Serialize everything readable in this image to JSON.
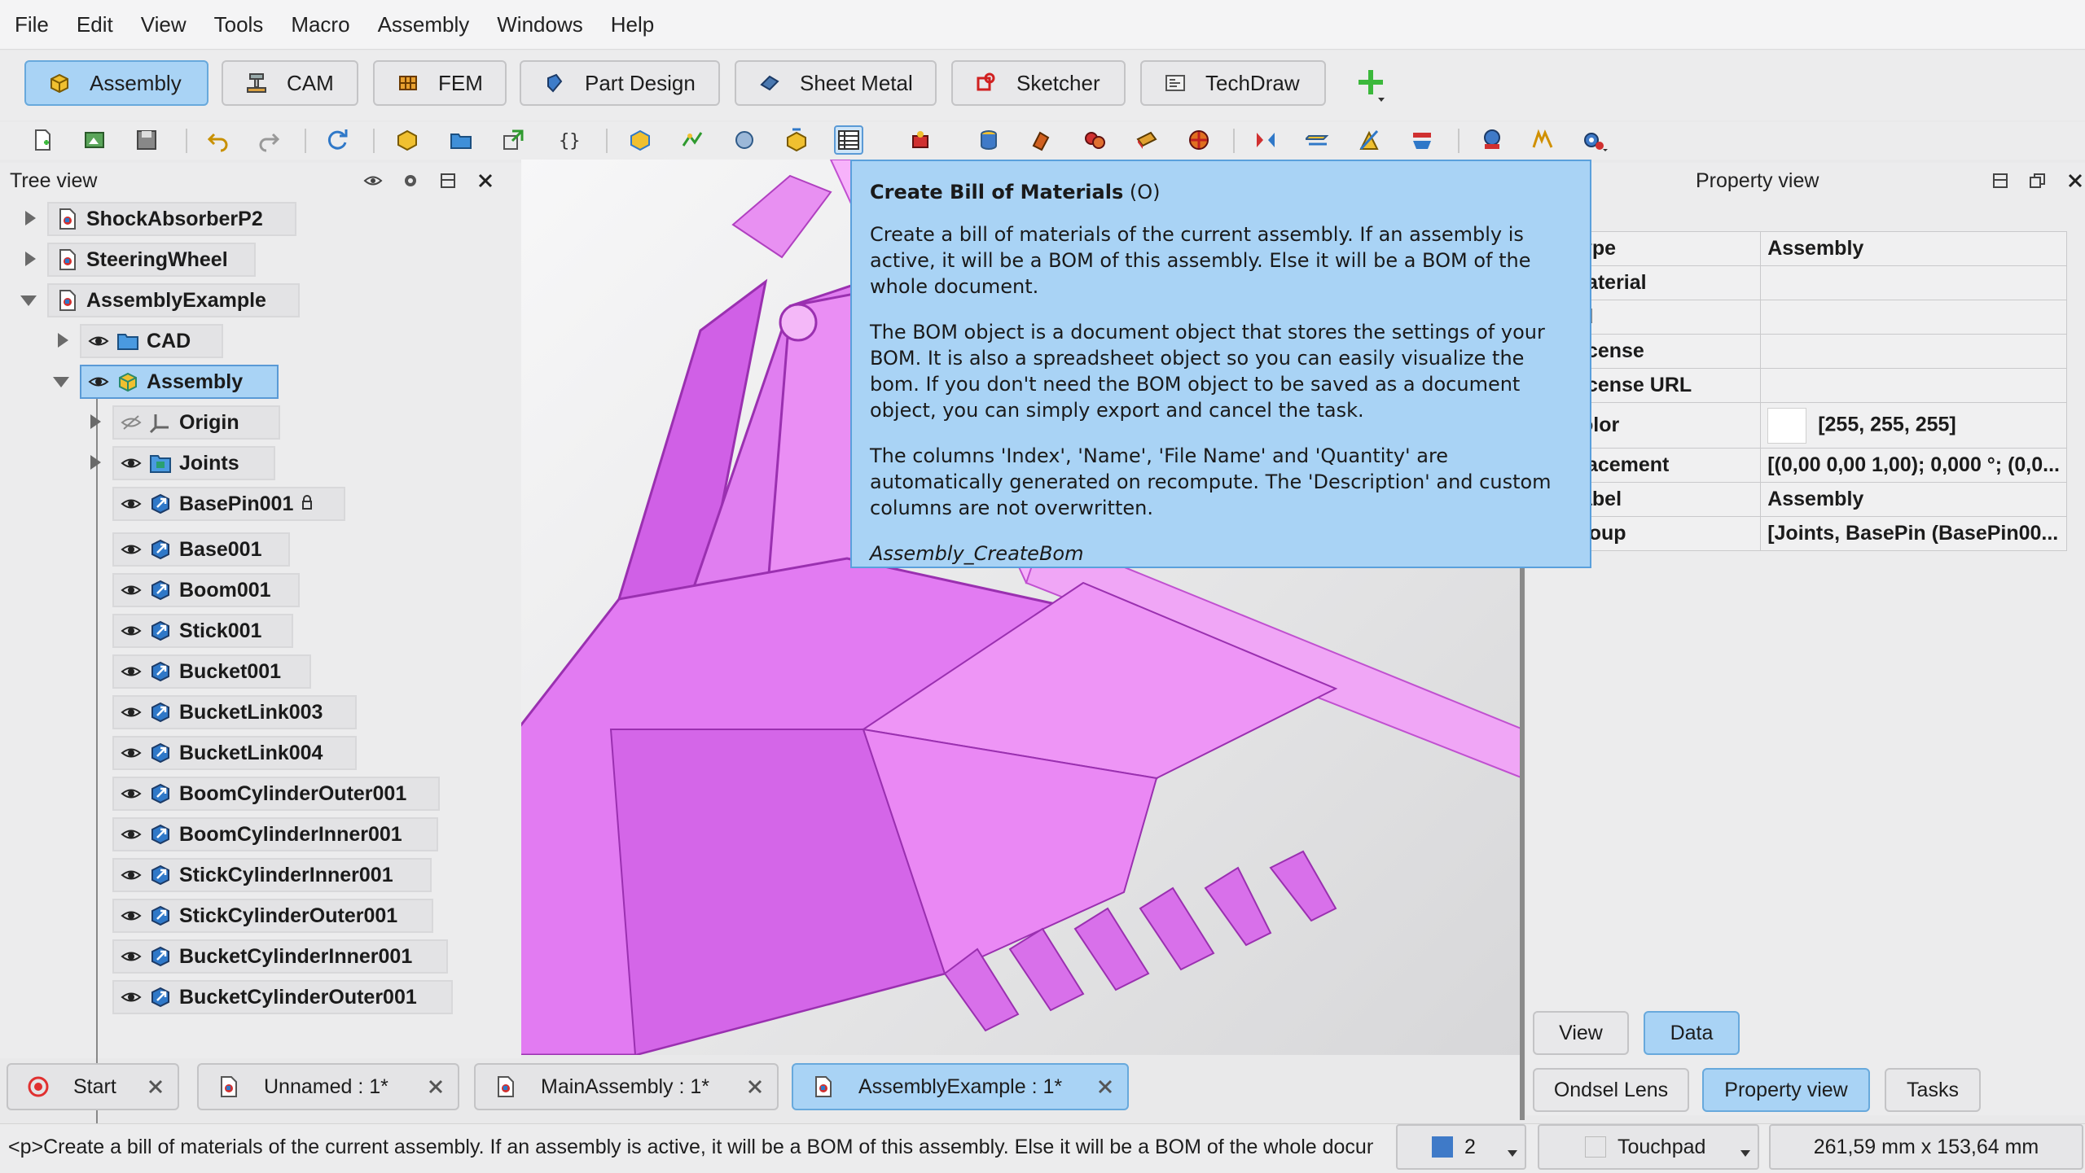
{
  "menu": [
    "File",
    "Edit",
    "View",
    "Tools",
    "Macro",
    "Assembly",
    "Windows",
    "Help"
  ],
  "workbenches": [
    {
      "label": "Assembly",
      "icon": "assembly-workbench-icon",
      "active": true
    },
    {
      "label": "CAM",
      "icon": "cam-workbench-icon",
      "active": false
    },
    {
      "label": "FEM",
      "icon": "fem-workbench-icon",
      "active": false
    },
    {
      "label": "Part Design",
      "icon": "part-design-workbench-icon",
      "active": false
    },
    {
      "label": "Sheet Metal",
      "icon": "sheet-metal-workbench-icon",
      "active": false
    },
    {
      "label": "Sketcher",
      "icon": "sketcher-workbench-icon",
      "active": false
    },
    {
      "label": "TechDraw",
      "icon": "techdraw-workbench-icon",
      "active": false
    }
  ],
  "tree": {
    "title": "Tree view",
    "items": [
      {
        "label": "ShockAbsorberP2",
        "icon": "document-icon"
      },
      {
        "label": "SteeringWheel",
        "icon": "document-icon"
      },
      {
        "label": "AssemblyExample",
        "icon": "document-icon"
      },
      {
        "label": "CAD",
        "icon": "folder-icon"
      },
      {
        "label": "Assembly",
        "icon": "assembly-icon"
      },
      {
        "label": "Origin",
        "icon": "origin-icon"
      },
      {
        "label": "Joints",
        "icon": "joints-icon"
      },
      {
        "label": "BasePin001",
        "icon": "link-icon"
      },
      {
        "label": "Base001",
        "icon": "link-icon"
      },
      {
        "label": "Boom001",
        "icon": "link-icon"
      },
      {
        "label": "Stick001",
        "icon": "link-icon"
      },
      {
        "label": "Bucket001",
        "icon": "link-icon"
      },
      {
        "label": "BucketLink003",
        "icon": "link-icon"
      },
      {
        "label": "BucketLink004",
        "icon": "link-icon"
      },
      {
        "label": "BoomCylinderOuter001",
        "icon": "link-icon"
      },
      {
        "label": "BoomCylinderInner001",
        "icon": "link-icon"
      },
      {
        "label": "StickCylinderInner001",
        "icon": "link-icon"
      },
      {
        "label": "StickCylinderOuter001",
        "icon": "link-icon"
      },
      {
        "label": "BucketCylinderInner001",
        "icon": "link-icon"
      },
      {
        "label": "BucketCylinderOuter001",
        "icon": "link-icon"
      }
    ]
  },
  "tooltip": {
    "title": "Create Bill of Materials",
    "shortcut": "(O)",
    "p1": "Create a bill of materials of the current assembly. If an assembly is active, it will be a BOM of this assembly. Else it will be a BOM of the whole document.",
    "p2": "The BOM object is a document object that stores the settings of your BOM. It is also a spreadsheet object so you can easily visualize the bom. If you don't need the BOM object to be saved as a document object, you can simply export and cancel the task.",
    "p3": "The columns 'Index', 'Name', 'File Name' and 'Quantity' are automatically generated on recompute. The 'Description' and custom columns are not overwritten.",
    "command": "Assembly_CreateBom"
  },
  "property_view": {
    "title": "Property view",
    "rows": [
      {
        "name": "ype",
        "value": ""
      },
      {
        "name": "laterial",
        "value": ""
      },
      {
        "name": "d",
        "value": ""
      },
      {
        "name": "icense",
        "value": ""
      },
      {
        "name": "icense URL",
        "value": ""
      },
      {
        "name": "olor",
        "value": "[255, 255, 255]"
      },
      {
        "name": "lacement",
        "value": "[(0,00 0,00 1,00); 0,000 °; (0,0..."
      },
      {
        "name": "abel",
        "value": "Assembly"
      },
      {
        "name": "roup",
        "value": "[Joints, BasePin (BasePin00..."
      }
    ],
    "type_value": "Assembly",
    "tabs": [
      "View",
      "Data"
    ],
    "panels": [
      "Ondsel Lens",
      "Property view",
      "Tasks"
    ]
  },
  "doc_tabs": [
    {
      "label": "Start",
      "active": false
    },
    {
      "label": "Unnamed : 1*",
      "active": false
    },
    {
      "label": "MainAssembly : 1*",
      "active": false
    },
    {
      "label": "AssemblyExample : 1*",
      "active": true
    }
  ],
  "status": {
    "text": "<p>Create a bill of materials of the current assembly. If an assembly is active, it will be a BOM of this assembly. Else it will be a BOM of the whole document.",
    "page_count": "2",
    "nav_style": "Touchpad",
    "dimensions": "261,59 mm x 153,64 mm"
  },
  "colors": {
    "accent": "#a9d3f5",
    "accent_border": "#5a9ad6",
    "model": "#e07ef0",
    "tooltip_bg": "#a9d3f5"
  }
}
